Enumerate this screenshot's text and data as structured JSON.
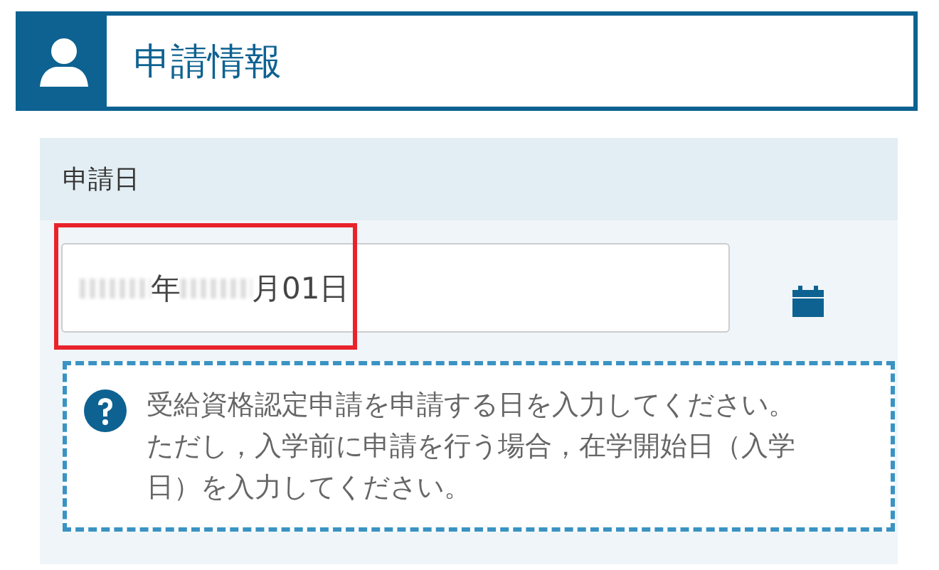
{
  "header": {
    "title": "申請情報"
  },
  "field": {
    "label": "申請日",
    "value_parts": [
      {
        "kind": "redacted"
      },
      {
        "kind": "text",
        "text": "年"
      },
      {
        "kind": "redacted"
      },
      {
        "kind": "text",
        "text": "月01日"
      }
    ],
    "highlighted": true
  },
  "help": {
    "text": "受給資格認定申請を申請する日を入力してください。ただし，入学前に申請を行う場合，在学開始日（入学日）を入力してください。"
  }
}
